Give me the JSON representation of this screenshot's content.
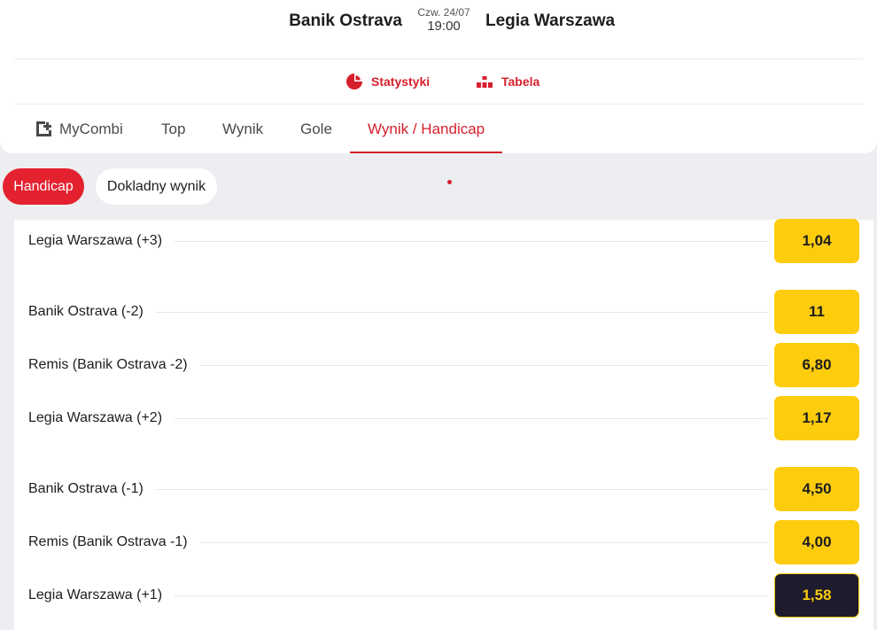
{
  "match": {
    "home_team": "Banik Ostrava",
    "away_team": "Legia Warszawa",
    "date": "Czw. 24/07",
    "time": "19:00"
  },
  "links": {
    "stats_label": "Statystyki",
    "stats_icon": "pie-chart-icon",
    "table_label": "Tabela",
    "table_icon": "podium-icon"
  },
  "tabs": [
    {
      "label": "MyCombi",
      "icon": "add-combi-icon"
    },
    {
      "label": "Top"
    },
    {
      "label": "Wynik"
    },
    {
      "label": "Gole"
    },
    {
      "label": "Wynik / Handicap",
      "active": true
    }
  ],
  "chips": [
    {
      "label": "Handicap",
      "active": true
    },
    {
      "label": "Dokladny wynik"
    }
  ],
  "markets": [
    {
      "label": "Legia Warszawa (+3)",
      "odds": "1,04"
    },
    {
      "label": "Banik Ostrava (-2)",
      "odds": "11"
    },
    {
      "label": "Remis (Banik Ostrava -2)",
      "odds": "6,80"
    },
    {
      "label": "Legia Warszawa (+2)",
      "odds": "1,17"
    },
    {
      "label": "Banik Ostrava (-1)",
      "odds": "4,50"
    },
    {
      "label": "Remis (Banik Ostrava -1)",
      "odds": "4,00"
    },
    {
      "label": "Legia Warszawa (+1)",
      "odds": "1,58",
      "selected": true
    }
  ],
  "colors": {
    "accent": "#d61f2c",
    "odds_bg": "#fdcc0d",
    "odds_selected_bg": "#1d1b2d"
  }
}
